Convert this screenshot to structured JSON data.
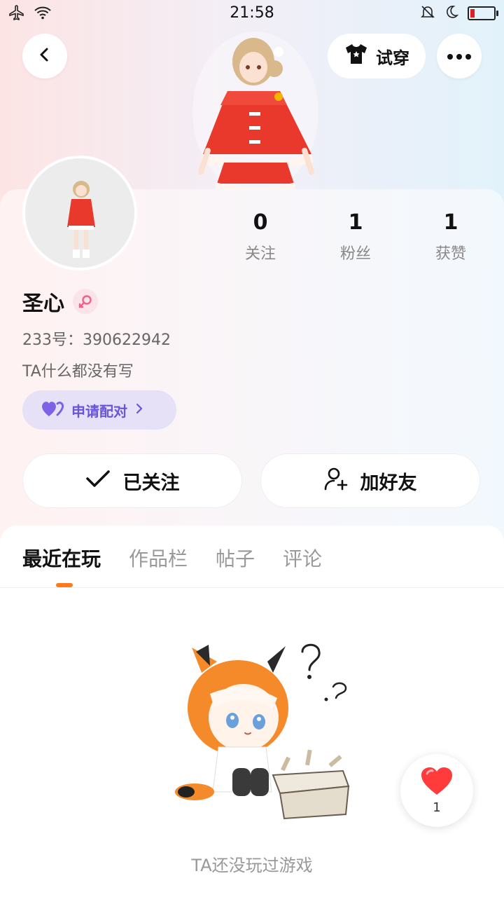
{
  "status_bar": {
    "time": "21:58",
    "icons": [
      "airplane-icon",
      "wifi-icon",
      "bell-off-icon",
      "moon-icon",
      "battery-icon"
    ]
  },
  "header": {
    "back_icon": "chevron-left-icon",
    "try_on_label": "试穿",
    "more_icon": "more-dots-icon"
  },
  "profile": {
    "name": "圣心",
    "gender": "female",
    "uid_text": "233号：390622942",
    "bio": "TA什么都没有写",
    "pair_label": "申请配对",
    "stats": [
      {
        "value": "0",
        "label": "关注"
      },
      {
        "value": "1",
        "label": "粉丝"
      },
      {
        "value": "1",
        "label": "获赞"
      }
    ]
  },
  "actions": {
    "followed_label": "已关注",
    "add_friend_label": "加好友"
  },
  "tabs": [
    {
      "label": "最近在玩",
      "active": true
    },
    {
      "label": "作品栏",
      "active": false
    },
    {
      "label": "帖子",
      "active": false
    },
    {
      "label": "评论",
      "active": false
    }
  ],
  "empty_state": {
    "text": "TA还没玩过游戏"
  },
  "like_float": {
    "count": "1"
  },
  "colors": {
    "accent_orange": "#ff7a1a",
    "pair_purple": "#6a55d9",
    "like_red": "#ff3b3b"
  }
}
